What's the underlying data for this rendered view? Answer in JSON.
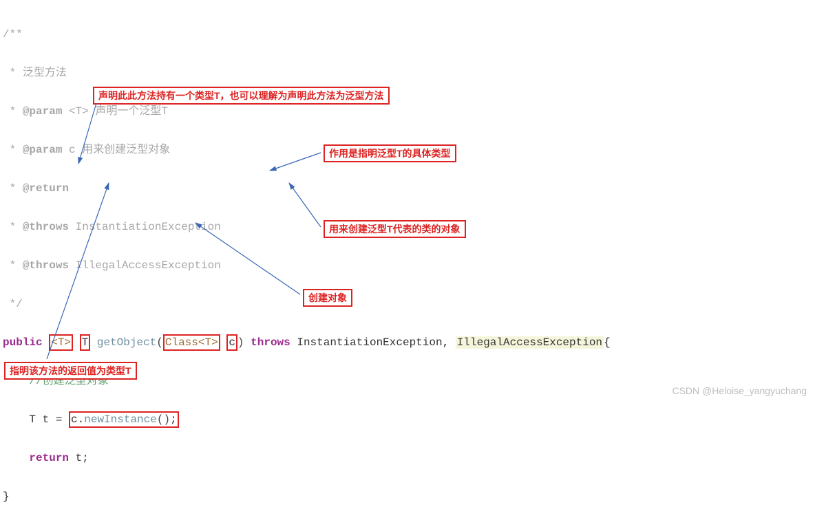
{
  "code": {
    "l1": "/**",
    "l2_star": " * ",
    "l2_text": "泛型方法",
    "l3_star": " * ",
    "l3_tag": "@param",
    "l3_text": " <T> 声明一个泛型T",
    "l4_star": " * ",
    "l4_tag": "@param",
    "l4_text": " c 用来创建泛型对象",
    "l5_star": " * ",
    "l5_tag": "@return",
    "l6_star": " * ",
    "l6_tag": "@throws",
    "l6_text": " InstantiationException",
    "l7_star": " * ",
    "l7_tag": "@throws",
    "l7_text": " IllegalAccessException",
    "l8": " */",
    "l9_public": "public",
    "l9_gen": "<T>",
    "l9_ret": "T",
    "l9_method": " getObject",
    "l9_lp": "(",
    "l9_class": "Class",
    "l9_ct": "<T>",
    "l9_param": "c",
    "l9_rp": ")",
    "l9_throws": "throws",
    "l9_ex": " InstantiationException, ",
    "l9_ex2": "IllegalAccessException",
    "l9_brace": "{",
    "l10_indent": "    ",
    "l10_comment": "//创建泛型对象",
    "l11_indent": "    T t = ",
    "l11_call": "c",
    "l11_dot": ".",
    "l11_new": "newInstance",
    "l11_p1": "(",
    "l11_p2": ")",
    "l11_semi": ";",
    "l12_indent": "    ",
    "l12_ret": "return",
    "l12_var": " t;",
    "l13": "}"
  },
  "ann": {
    "a1": "声明此此方法持有一个类型T，也可以理解为声明此方法为泛型方法",
    "a2": "作用是指明泛型T的具体类型",
    "a3": "用来创建泛型T代表的类的对象",
    "a4": "创建对象",
    "a5": "指明该方法的返回值为类型T"
  },
  "watermark": "CSDN @Heloise_yangyuchang"
}
